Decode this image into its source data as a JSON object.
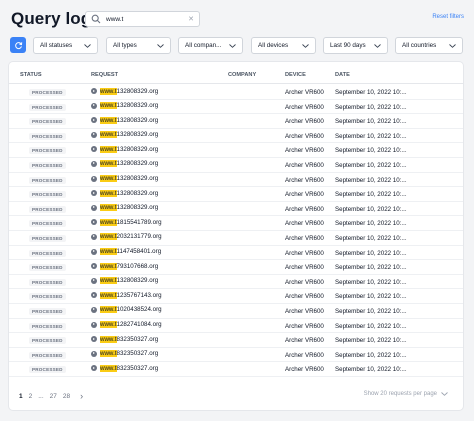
{
  "header": {
    "title": "Query log",
    "search_value": "www.t",
    "reset_label": "Reset filters"
  },
  "filters": [
    {
      "label": "All statuses"
    },
    {
      "label": "All types"
    },
    {
      "label": "All compan..."
    },
    {
      "label": "All devices"
    },
    {
      "label": "Last 90 days"
    },
    {
      "label": "All countries"
    }
  ],
  "table": {
    "columns": {
      "status": "STATUS",
      "request": "REQUEST",
      "company": "COMPANY",
      "device": "DEVICE",
      "date": "DATE"
    },
    "rows": [
      {
        "status": "PROCESSED",
        "req_hl": "www.t",
        "req_rest": "132808329.org",
        "company": "",
        "device": "Archer VR600",
        "date": "September 10, 2022 10:..."
      },
      {
        "status": "PROCESSED",
        "req_hl": "www.t",
        "req_rest": "132808329.org",
        "company": "",
        "device": "Archer VR600",
        "date": "September 10, 2022 10:..."
      },
      {
        "status": "PROCESSED",
        "req_hl": "www.t",
        "req_rest": "132808329.org",
        "company": "",
        "device": "Archer VR600",
        "date": "September 10, 2022 10:..."
      },
      {
        "status": "PROCESSED",
        "req_hl": "www.t",
        "req_rest": "132808329.org",
        "company": "",
        "device": "Archer VR600",
        "date": "September 10, 2022 10:..."
      },
      {
        "status": "PROCESSED",
        "req_hl": "www.t",
        "req_rest": "132808329.org",
        "company": "",
        "device": "Archer VR600",
        "date": "September 10, 2022 10:..."
      },
      {
        "status": "PROCESSED",
        "req_hl": "www.t",
        "req_rest": "132808329.org",
        "company": "",
        "device": "Archer VR600",
        "date": "September 10, 2022 10:..."
      },
      {
        "status": "PROCESSED",
        "req_hl": "www.t",
        "req_rest": "132808329.org",
        "company": "",
        "device": "Archer VR600",
        "date": "September 10, 2022 10:..."
      },
      {
        "status": "PROCESSED",
        "req_hl": "www.t",
        "req_rest": "132808329.org",
        "company": "",
        "device": "Archer VR600",
        "date": "September 10, 2022 10:..."
      },
      {
        "status": "PROCESSED",
        "req_hl": "www.t",
        "req_rest": "132808329.org",
        "company": "",
        "device": "Archer VR600",
        "date": "September 10, 2022 10:..."
      },
      {
        "status": "PROCESSED",
        "req_hl": "www.t",
        "req_rest": "1815541789.org",
        "company": "",
        "device": "Archer VR600",
        "date": "September 10, 2022 10:..."
      },
      {
        "status": "PROCESSED",
        "req_hl": "www.t",
        "req_rest": "2032131779.org",
        "company": "",
        "device": "Archer VR600",
        "date": "September 10, 2022 10:..."
      },
      {
        "status": "PROCESSED",
        "req_hl": "www.t",
        "req_rest": "1147458401.org",
        "company": "",
        "device": "Archer VR600",
        "date": "September 10, 2022 10:..."
      },
      {
        "status": "PROCESSED",
        "req_hl": "www.t",
        "req_rest": "793107668.org",
        "company": "",
        "device": "Archer VR600",
        "date": "September 10, 2022 10:..."
      },
      {
        "status": "PROCESSED",
        "req_hl": "www.t",
        "req_rest": "132808329.org",
        "company": "",
        "device": "Archer VR600",
        "date": "September 10, 2022 10:..."
      },
      {
        "status": "PROCESSED",
        "req_hl": "www.t",
        "req_rest": "1235767143.org",
        "company": "",
        "device": "Archer VR600",
        "date": "September 10, 2022 10:..."
      },
      {
        "status": "PROCESSED",
        "req_hl": "www.t",
        "req_rest": "1020438524.org",
        "company": "",
        "device": "Archer VR600",
        "date": "September 10, 2022 10:..."
      },
      {
        "status": "PROCESSED",
        "req_hl": "www.t",
        "req_rest": "1282741084.org",
        "company": "",
        "device": "Archer VR600",
        "date": "September 10, 2022 10:..."
      },
      {
        "status": "PROCESSED",
        "req_hl": "www.t",
        "req_rest": "832350327.org",
        "company": "",
        "device": "Archer VR600",
        "date": "September 10, 2022 10:..."
      },
      {
        "status": "PROCESSED",
        "req_hl": "www.t",
        "req_rest": "832350327.org",
        "company": "",
        "device": "Archer VR600",
        "date": "September 10, 2022 10:..."
      },
      {
        "status": "PROCESSED",
        "req_hl": "www.t",
        "req_rest": "832350327.org",
        "company": "",
        "device": "Archer VR600",
        "date": "September 10, 2022 10:..."
      }
    ]
  },
  "pagination": {
    "pages": [
      "1",
      "2",
      "...",
      "27",
      "28"
    ],
    "next_symbol": "›",
    "per_page_label": "Show 20 requests per page"
  },
  "colors": {
    "accent": "#3b82f6",
    "highlight": "#facc15"
  }
}
